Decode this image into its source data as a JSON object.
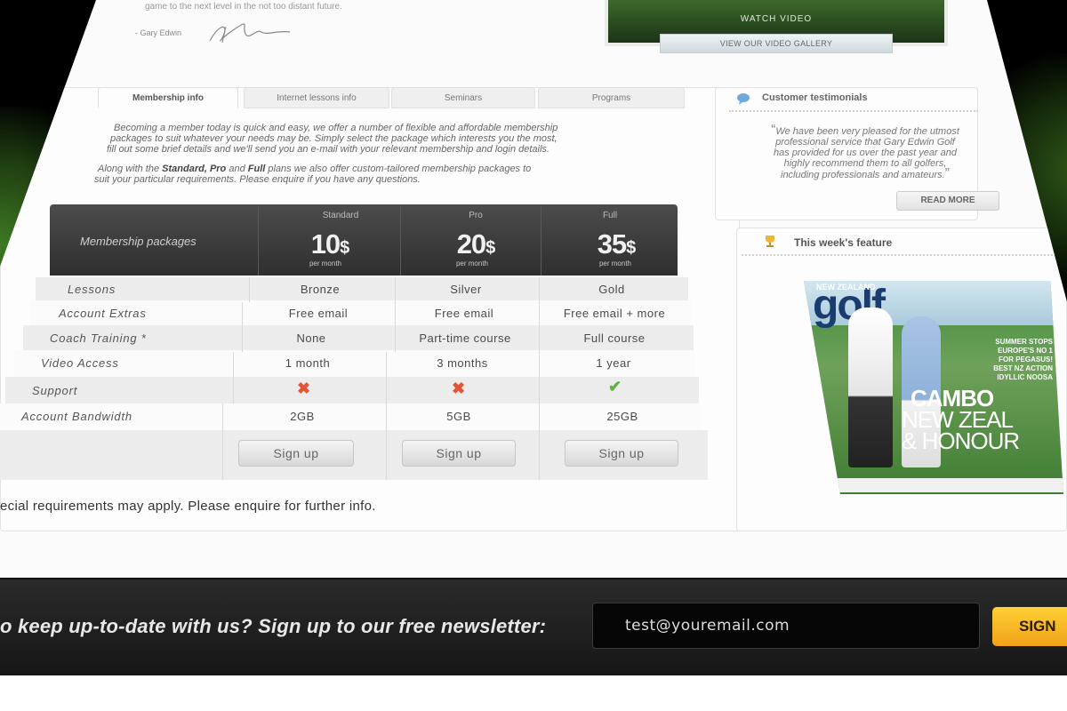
{
  "top": {
    "quote_line": "game to the next level in the not too distant future.",
    "author": "- Gary Edwin",
    "watch_video": "WATCH VIDEO",
    "video_gallery": "VIEW OUR VIDEO GALLERY"
  },
  "tabs": [
    {
      "label": "Membership info",
      "active": true
    },
    {
      "label": "Internet lessons info",
      "active": false
    },
    {
      "label": "Seminars",
      "active": false
    },
    {
      "label": "Programs",
      "active": false
    }
  ],
  "intro": {
    "p1_l1": "Becoming a member today is quick and easy, we offer a number of flexible and affordable membership",
    "p1_l2": "packages to suit whatever your needs may be. Simply select the package which interests you the most,",
    "p1_l3": "fill out some brief details and we'll send you an e-mail with your relevant membership and login details.",
    "p2_pre": "Along with the ",
    "p2_standard": "Standard, Pro",
    "p2_and": " and ",
    "p2_full": "Full",
    "p2_post": " plans  we also offer custom-tailored membership packages to",
    "p2_l2": "suit your particular requirements. Please enquire if you have any questions."
  },
  "pricing": {
    "title": "Membership packages",
    "per_month": "per month",
    "currency": "$",
    "plans": [
      {
        "name": "Standard",
        "price": "10"
      },
      {
        "name": "Pro",
        "price": "20"
      },
      {
        "name": "Full",
        "price": "35"
      }
    ],
    "features": [
      "Lessons",
      "Account Extras",
      "Coach Training *",
      "Video Access",
      "Support",
      "Account Bandwidth"
    ],
    "rows": [
      [
        "Bronze",
        "Silver",
        "Gold"
      ],
      [
        "Free email",
        "Free email",
        "Free email + more"
      ],
      [
        "None",
        "Part-time course",
        "Full course"
      ],
      [
        "1 month",
        "3 months",
        "1 year"
      ],
      [
        "no",
        "no",
        "yes"
      ],
      [
        "2GB",
        "5GB",
        "25GB"
      ]
    ],
    "signup_label": "Sign up",
    "footnote": "ecial requirements may apply. Please enquire for further info."
  },
  "testimonials": {
    "heading": "Customer testimonials",
    "open_quote": "“",
    "close_quote": "”",
    "text_l1": "We have been very pleased for the utmost",
    "text_l2": "professional service that Gary Edwin Golf",
    "text_l3": "has provided for us over the past year and",
    "text_l4": "highly recommend them to all golfers,",
    "text_l5": "including professionals and amateurs.",
    "read_more": "READ MORE"
  },
  "feature": {
    "heading": "This week's feature",
    "mag_nz": "NEW ZEALAND",
    "mag_title": "golf",
    "mag_line1": "SUMMER STOPS",
    "mag_line2": "EUROPE'S NO 1",
    "mag_line3": "FOR PEGASUS!",
    "mag_line4": "BEST NZ ACTION",
    "mag_line5": "IDYLLIC NOOSA",
    "mag_cambo": "CAMBO",
    "mag_nzl": "NEW ZEAL",
    "mag_honour": "& HONOUR"
  },
  "newsletter": {
    "text": "o keep up-to-date with us? Sign up to our free newsletter:",
    "email_value": "test@youremail.com",
    "button": "SIGN"
  },
  "colors": {
    "newsletter_bg": "#1c1c1c",
    "button_gold": "#f5b623",
    "cross_red": "#e2553b",
    "check_green": "#5fb246"
  }
}
